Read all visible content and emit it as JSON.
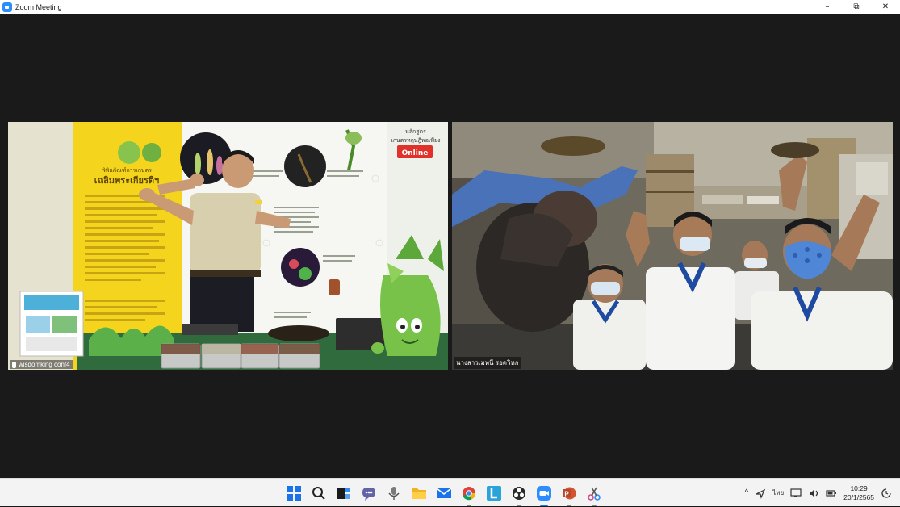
{
  "window": {
    "title": "Zoom Meeting",
    "minimize_glyph": "–",
    "maximize_glyph": "⧉",
    "close_glyph": "✕"
  },
  "participants": [
    {
      "name": "wisdomking conf4",
      "icon": "pin-icon"
    },
    {
      "name": "นางสาวเมทนี รอดวิหก"
    }
  ],
  "left_video": {
    "board_title": "พิพิธภัณฑ์การเกษตร",
    "board_subtitle": "เฉลิมพระเกียรติฯ",
    "poster_heading": "หลักสูตร",
    "poster_subheading": "เกษตรทฤษฎีพอเพียง",
    "poster_badge": "Online"
  },
  "taskbar": {
    "apps": [
      {
        "name": "start-button",
        "icon": "windows-icon",
        "state": ""
      },
      {
        "name": "search-button",
        "icon": "search-icon",
        "state": ""
      },
      {
        "name": "task-view-button",
        "icon": "task-view-icon",
        "state": ""
      },
      {
        "name": "teams-chat-button",
        "icon": "chat-icon",
        "state": ""
      },
      {
        "name": "voice-recorder-button",
        "icon": "microphone-icon",
        "state": ""
      },
      {
        "name": "file-explorer-button",
        "icon": "folder-icon",
        "state": ""
      },
      {
        "name": "mail-button",
        "icon": "mail-icon",
        "state": ""
      },
      {
        "name": "chrome-button",
        "icon": "chrome-icon",
        "state": "running"
      },
      {
        "name": "l-app-button",
        "icon": "l-app-icon",
        "state": ""
      },
      {
        "name": "obs-button",
        "icon": "obs-icon",
        "state": "running"
      },
      {
        "name": "zoom-button",
        "icon": "zoom-icon",
        "state": "active"
      },
      {
        "name": "powerpoint-button",
        "icon": "powerpoint-icon",
        "state": "running"
      },
      {
        "name": "snipping-tool-button",
        "icon": "snipping-icon",
        "state": "running"
      }
    ],
    "tray": {
      "chevron": "^",
      "language": "ไทย",
      "time": "10:29",
      "date": "20/1/2565"
    }
  },
  "colors": {
    "zoom_blue": "#2d8cff",
    "meeting_bg": "#1a1a1a",
    "taskbar_bg": "#f3f3f3",
    "poster_yellow": "#f4d41c",
    "uniform_blue": "#1e4aa0"
  }
}
